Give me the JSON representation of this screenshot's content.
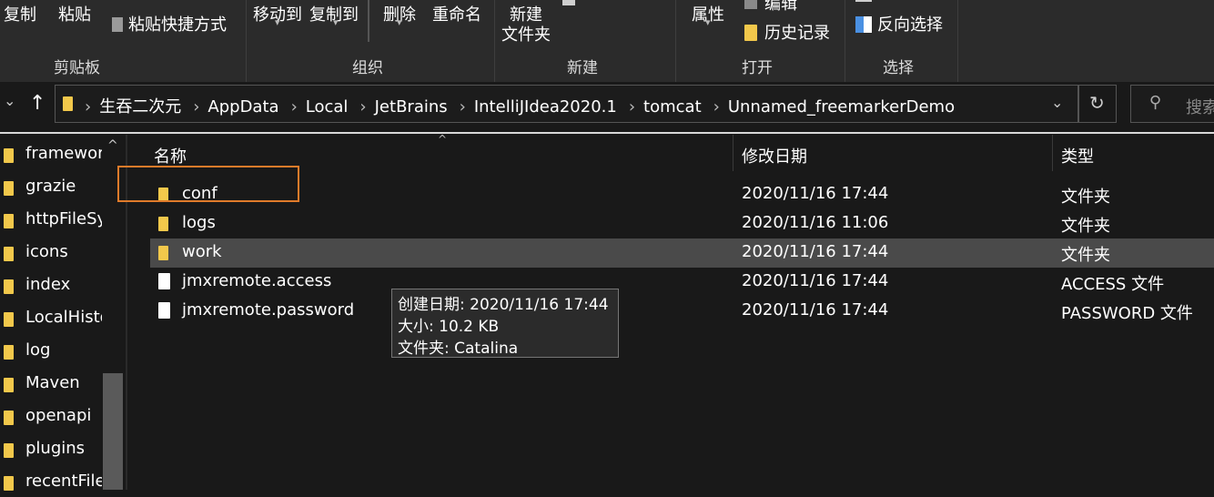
{
  "ribbon": {
    "copy": "复制",
    "paste": "粘贴",
    "paste_shortcut": "粘贴快捷方式",
    "move_to": "移动到",
    "copy_to": "复制到",
    "delete": "删除",
    "rename": "重命名",
    "new_folder_line1": "新建",
    "new_folder_line2": "文件夹",
    "properties": "属性",
    "edit": "编辑",
    "history": "历史记录",
    "invert_selection": "反向选择",
    "groups": {
      "clipboard": "剪贴板",
      "organize": "组织",
      "new": "新建",
      "open": "打开",
      "select": "选择"
    }
  },
  "nav": {
    "up_arrow": "↑",
    "back_arrow": "⌄",
    "refresh": "↻",
    "dropdown": "⌄"
  },
  "breadcrumb": [
    "生吞二次元",
    "AppData",
    "Local",
    "JetBrains",
    "IntelliJIdea2020.1",
    "tomcat",
    "Unnamed_freemarkerDemo"
  ],
  "breadcrumb_separator": "›",
  "search": {
    "placeholder": "搜索"
  },
  "sidebar": {
    "items": [
      {
        "label": "framewor"
      },
      {
        "label": "grazie"
      },
      {
        "label": "httpFileSy"
      },
      {
        "label": "icons"
      },
      {
        "label": "index"
      },
      {
        "label": "LocalHisto"
      },
      {
        "label": "log"
      },
      {
        "label": "Maven"
      },
      {
        "label": "openapi"
      },
      {
        "label": "plugins"
      },
      {
        "label": "recentFile"
      }
    ]
  },
  "columns": {
    "name": "名称",
    "date": "修改日期",
    "type": "类型"
  },
  "files": [
    {
      "name": "conf",
      "date": "2020/11/16 17:44",
      "type": "文件夹",
      "icon": "folder-icon"
    },
    {
      "name": "logs",
      "date": "2020/11/16 11:06",
      "type": "文件夹",
      "icon": "folder-icon"
    },
    {
      "name": "work",
      "date": "2020/11/16 17:44",
      "type": "文件夹",
      "icon": "folder-icon"
    },
    {
      "name": "jmxremote.access",
      "date": "2020/11/16 17:44",
      "type": "ACCESS 文件",
      "icon": "file-icon"
    },
    {
      "name": "jmxremote.password",
      "date": "2020/11/16 17:44",
      "type": "PASSWORD 文件",
      "icon": "file-icon"
    }
  ],
  "tooltip": {
    "created": "创建日期: 2020/11/16 17:44",
    "size": "大小: 10.2 KB",
    "folder": "文件夹: Catalina"
  },
  "colors": {
    "highlight": "#e07b2a",
    "hover_row": "#4a4a4a",
    "folder": "#f2c84b"
  }
}
